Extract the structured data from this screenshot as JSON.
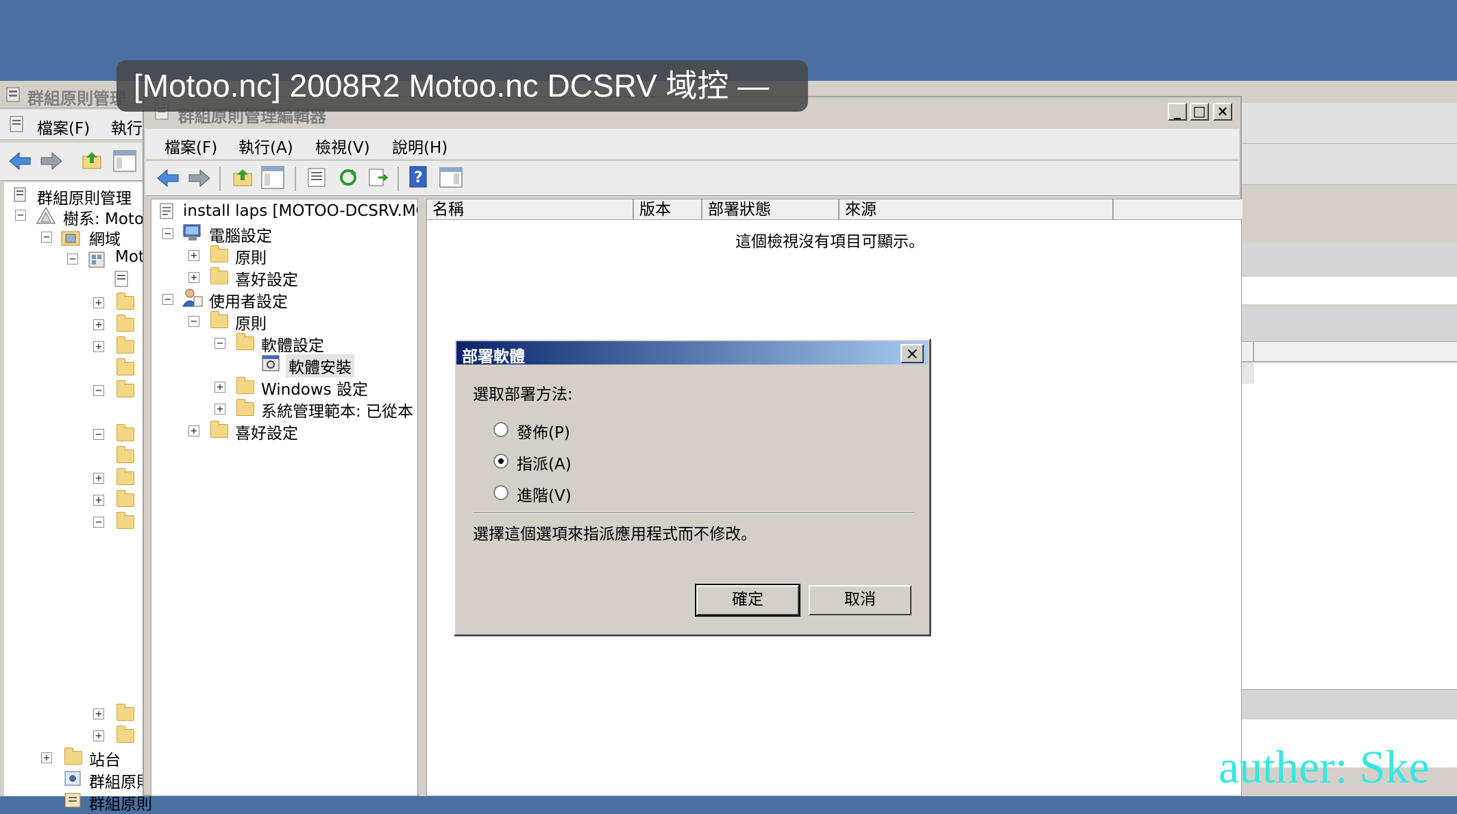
{
  "overlay": {
    "title": "[Motoo.nc] 2008R2 Motoo.nc DCSRV 域控 —"
  },
  "back_window": {
    "title": "群組原則管理",
    "menu": [
      "檔案(F)",
      "執行"
    ],
    "tree": [
      {
        "label": "群組原則管理"
      },
      {
        "label": "樹系: Motoo"
      },
      {
        "label": "網域"
      },
      {
        "label": "Mot"
      },
      {
        "label": "站台"
      },
      {
        "label": "群組原則"
      },
      {
        "label": "群組原則"
      }
    ]
  },
  "front_window": {
    "title": "群組原則管理編輯器",
    "caption_buttons": [
      "_",
      "□",
      "×"
    ],
    "menu": [
      "檔案(F)",
      "執行(A)",
      "檢視(V)",
      "說明(H)"
    ],
    "tree": {
      "root": "install laps [MOTOO-DCSRV.MOT",
      "computer_config": "電腦設定",
      "policies": "原則",
      "preferences": "喜好設定",
      "user_config": "使用者設定",
      "user_policies": "原則",
      "software_settings": "軟體設定",
      "software_install": "軟體安裝",
      "windows_settings": "Windows 設定",
      "admin_templates": "系統管理範本: 已從本",
      "user_preferences": "喜好設定"
    },
    "list": {
      "columns": [
        "名稱",
        "版本",
        "部署狀態",
        "來源"
      ],
      "empty_message": "這個檢視沒有項目可顯示。"
    }
  },
  "dialog": {
    "title": "部署軟體",
    "prompt": "選取部署方法:",
    "options": [
      {
        "label": "發佈(P)",
        "selected": false
      },
      {
        "label": "指派(A)",
        "selected": true
      },
      {
        "label": "進階(V)",
        "selected": false
      }
    ],
    "description": "選擇這個選項來指派應用程式而不修改。",
    "ok": "確定",
    "cancel": "取消",
    "close": "×"
  },
  "watermark": "auther: Ske",
  "colors": {
    "desktop": "#4a6fa3",
    "dialog_title_start": "#0a246a",
    "watermark": "#38e6e0"
  }
}
